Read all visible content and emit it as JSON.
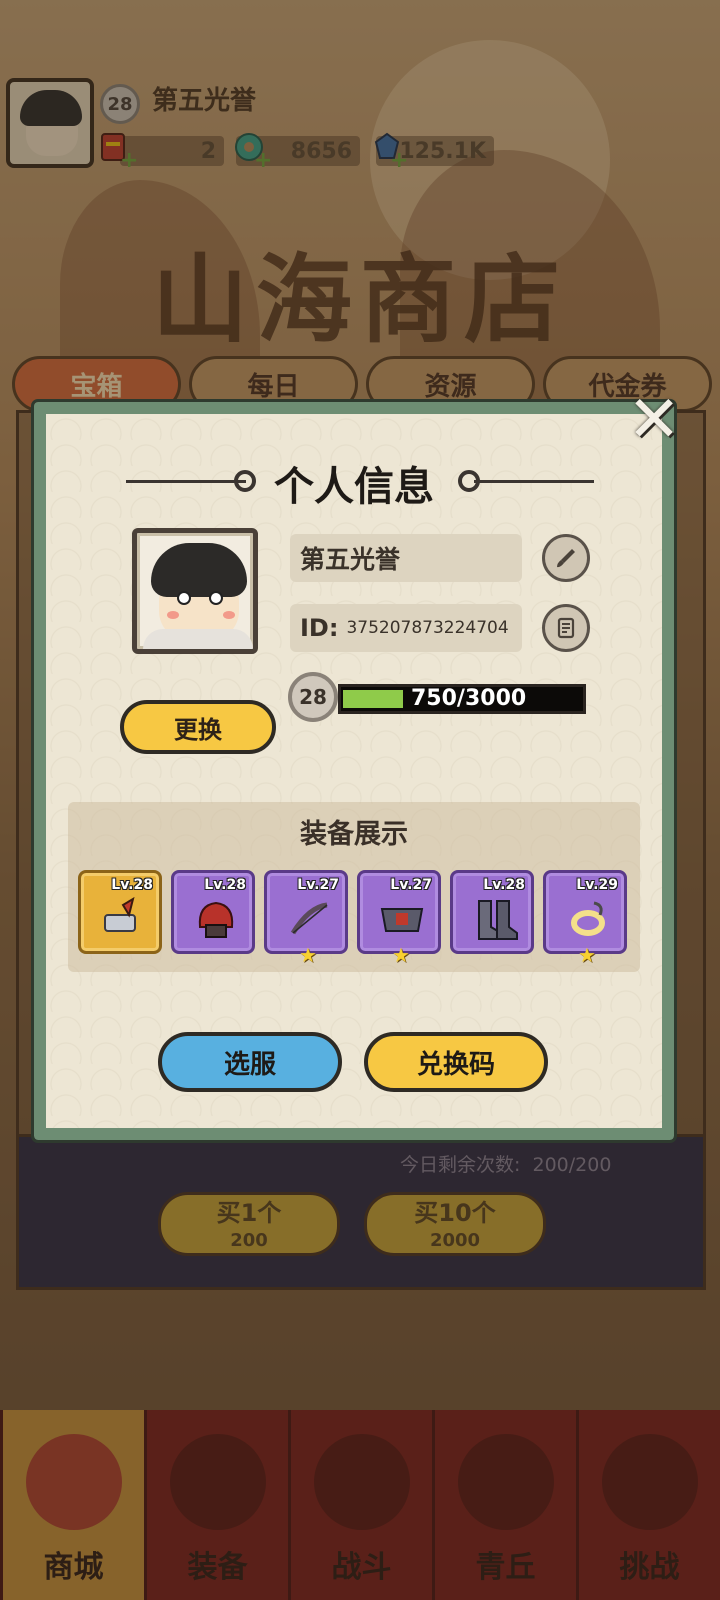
{
  "header": {
    "level": "28",
    "player_name": "第五光誉",
    "resources": [
      {
        "icon": "red-envelope-icon",
        "value": "2"
      },
      {
        "icon": "jade-coin-icon",
        "value": "8656"
      },
      {
        "icon": "blue-crystal-icon",
        "value": "125.1K"
      }
    ]
  },
  "shop": {
    "title": "山海商店",
    "tabs": [
      "宝箱",
      "每日",
      "资源",
      "代金券"
    ],
    "remaining_label": "今日剩余次数:",
    "remaining_value": "200/200",
    "buy_one": {
      "label": "买1个",
      "cost": "200"
    },
    "buy_ten": {
      "label": "买10个",
      "cost": "2000"
    }
  },
  "modal": {
    "title": "个人信息",
    "name": "第五光誉",
    "id_label": "ID:",
    "id_value": "375207873224704",
    "level": "28",
    "xp_text": "750/3000",
    "xp_current": 750,
    "xp_max": 3000,
    "change_button": "更换",
    "equip_title": "装备展示",
    "equipment": [
      {
        "level": "Lv.28",
        "rarity": "gold",
        "icon": "hammer-icon",
        "star": false
      },
      {
        "level": "Lv.28",
        "rarity": "purple",
        "icon": "helmet-icon",
        "star": false
      },
      {
        "level": "Lv.27",
        "rarity": "purple",
        "icon": "bow-icon",
        "star": true
      },
      {
        "level": "Lv.27",
        "rarity": "purple",
        "icon": "belt-icon",
        "star": true
      },
      {
        "level": "Lv.28",
        "rarity": "purple",
        "icon": "boots-icon",
        "star": false
      },
      {
        "level": "Lv.29",
        "rarity": "purple",
        "icon": "ring-icon",
        "star": true
      }
    ],
    "select_server_button": "选服",
    "redeem_code_button": "兑换码"
  },
  "bottom_nav": [
    {
      "label": "商城",
      "icon": "shop-icon",
      "active": true
    },
    {
      "label": "装备",
      "icon": "armor-icon",
      "active": false
    },
    {
      "label": "战斗",
      "icon": "crossed-swords-icon",
      "active": false
    },
    {
      "label": "青丘",
      "icon": "mountain-icon",
      "active": false
    },
    {
      "label": "挑战",
      "icon": "challenge-orb-icon",
      "active": false
    }
  ]
}
